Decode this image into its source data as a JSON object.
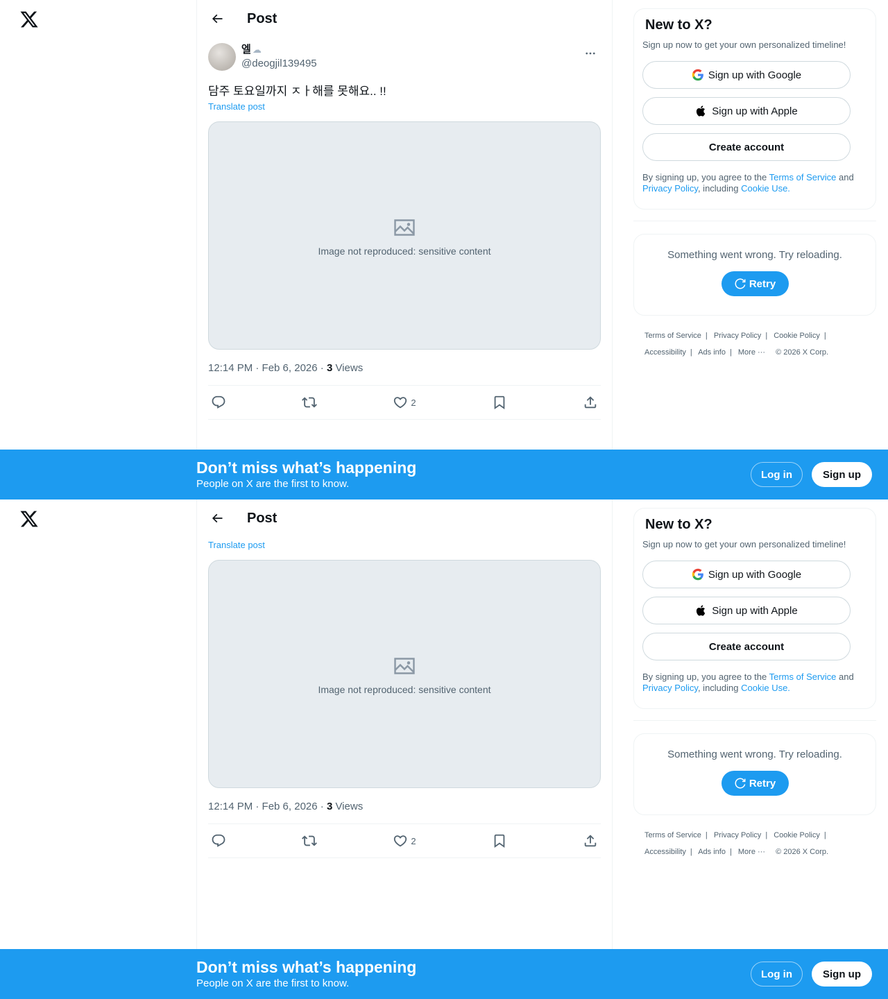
{
  "header": {
    "title": "Post"
  },
  "post": {
    "display_name": "엘",
    "handle": "@deogjil139495",
    "text": "담주 토요일까지 ㅈㅏ해를 못해요.. !!",
    "translate_label": "Translate post",
    "media_notice": "Image not reproduced: sensitive content",
    "time": "12:14 PM · Feb 6, 2026 · ",
    "views_count": "3",
    "views_label": " Views",
    "likes": "2"
  },
  "sidebar": {
    "title": "New to X?",
    "subtitle": "Sign up now to get your own personalized timeline!",
    "google_label": "Sign up with Google",
    "apple_label": "Sign up with Apple",
    "create_label": "Create account",
    "legal_prefix": "By signing up, you agree to the ",
    "terms_link": "Terms of Service",
    "legal_and": " and ",
    "privacy_link": "Privacy Policy",
    "legal_including": ", including ",
    "cookie_link": "Cookie Use.",
    "error_text": "Something went wrong. Try reloading.",
    "retry_label": "Retry"
  },
  "footer": {
    "terms": "Terms of Service",
    "privacy": "Privacy Policy",
    "cookie": "Cookie Policy",
    "accessibility": "Accessibility",
    "ads": "Ads info",
    "more": "More ···",
    "copyright": "© 2026 X Corp."
  },
  "banner": {
    "title": "Don’t miss what’s happening",
    "subtitle": "People on X are the first to know.",
    "login": "Log in",
    "signup": "Sign up"
  },
  "colors": {
    "accent": "#1d9bf0",
    "text": "#0f1419",
    "muted": "#536471",
    "border": "#eff3f4"
  },
  "icons": [
    "x-logo-icon",
    "back-arrow-icon",
    "more-icon",
    "reply-icon",
    "repost-icon",
    "like-icon",
    "bookmark-icon",
    "share-icon",
    "google-icon",
    "apple-icon",
    "refresh-icon"
  ]
}
